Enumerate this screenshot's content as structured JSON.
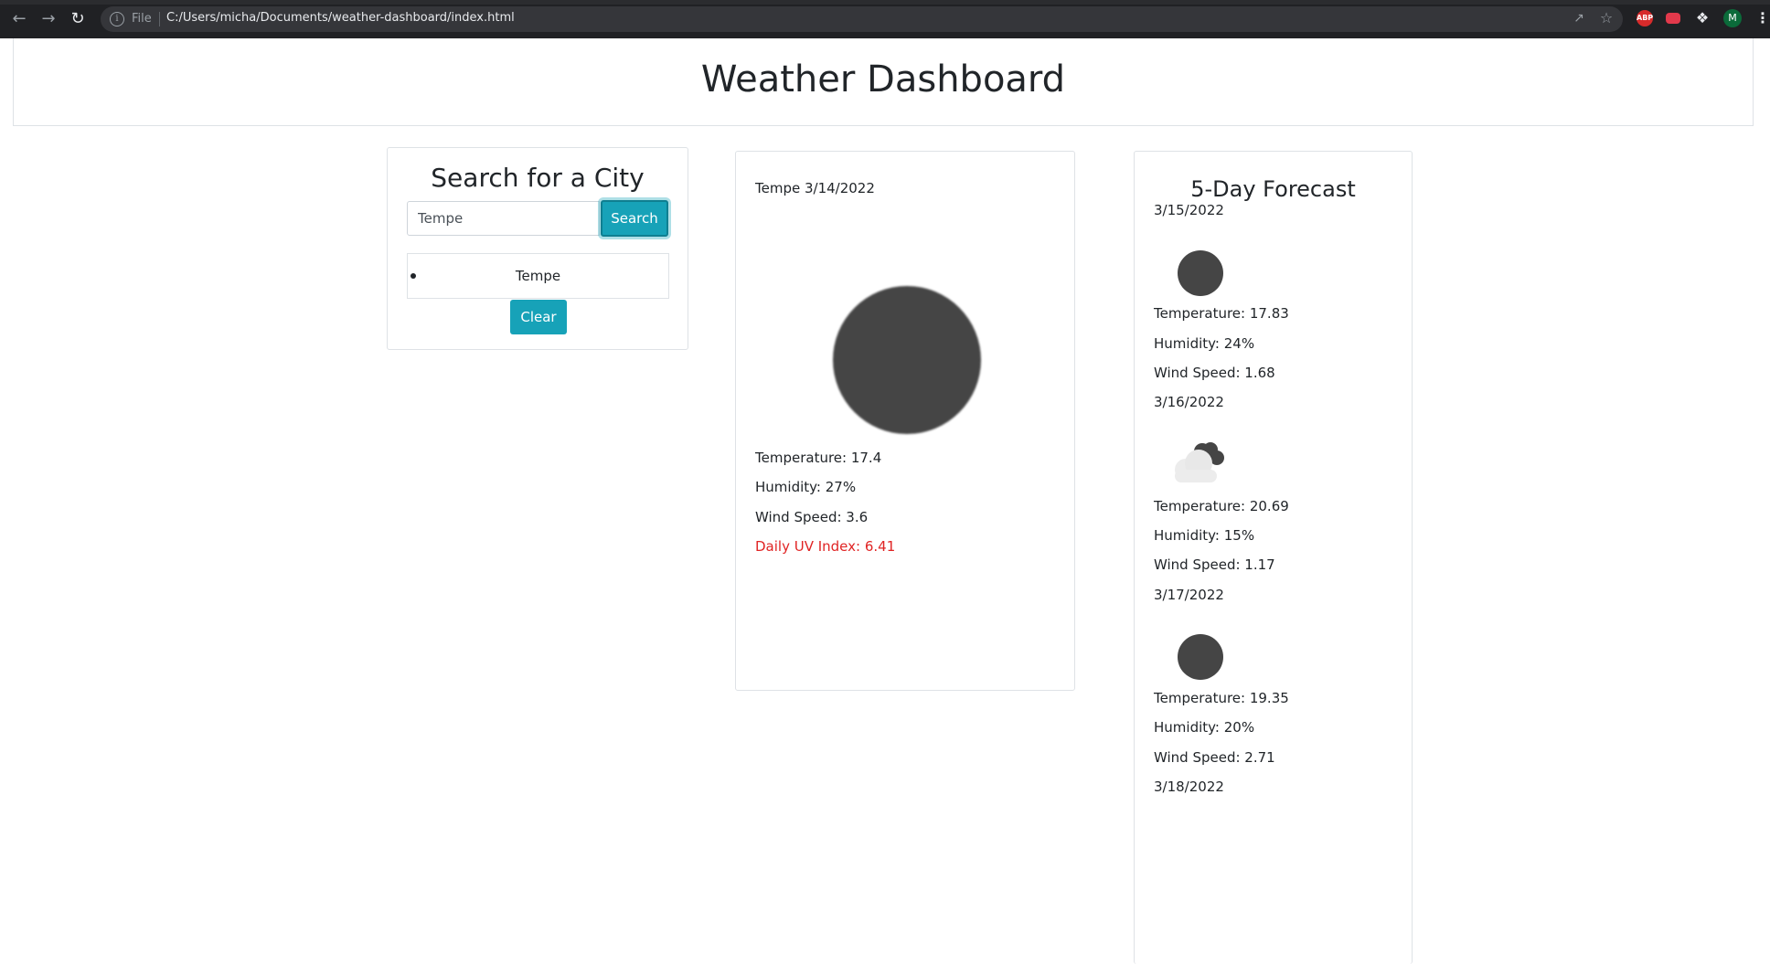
{
  "browser": {
    "scheme_label": "File",
    "url": "C:/Users/micha/Documents/weather-dashboard/index.html",
    "profile_initial": "M",
    "abp_label": "ABP"
  },
  "header": {
    "title": "Weather Dashboard"
  },
  "search": {
    "title": "Search for a City",
    "input_value": "Tempe",
    "button_label": "Search",
    "history": [
      "Tempe"
    ],
    "clear_label": "Clear"
  },
  "current": {
    "heading": "Tempe 3/14/2022",
    "icon": "clear-sky-icon",
    "temperature": "Temperature: 17.4",
    "humidity": "Humidity: 27%",
    "wind": "Wind Speed: 3.6",
    "uv": "Daily UV Index: 6.41",
    "uv_color": "#e02424"
  },
  "forecast": {
    "title": "5-Day Forecast",
    "days": [
      {
        "date": "3/15/2022",
        "icon": "clear-sky-icon",
        "temperature": "Temperature: 17.83",
        "humidity": "Humidity: 24%",
        "wind": "Wind Speed: 1.68"
      },
      {
        "date": "3/16/2022",
        "icon": "partly-cloudy-icon",
        "temperature": "Temperature: 20.69",
        "humidity": "Humidity: 15%",
        "wind": "Wind Speed: 1.17"
      },
      {
        "date": "3/17/2022",
        "icon": "clear-sky-icon",
        "temperature": "Temperature: 19.35",
        "humidity": "Humidity: 20%",
        "wind": "Wind Speed: 2.71"
      },
      {
        "date": "3/18/2022"
      }
    ]
  },
  "colors": {
    "accent": "#17a2b8",
    "chrome_bg": "#202124"
  }
}
